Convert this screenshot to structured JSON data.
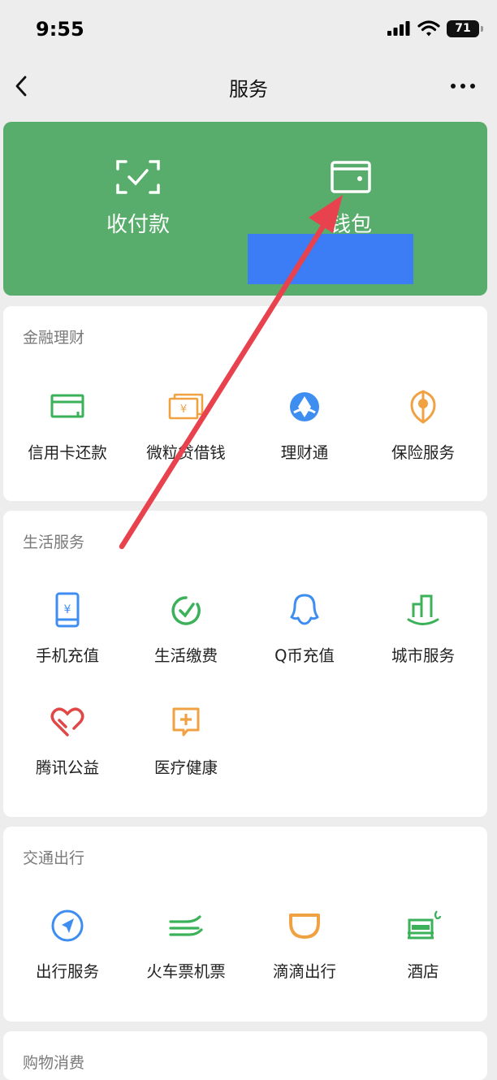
{
  "status_bar": {
    "time": "9:55",
    "battery": "71"
  },
  "nav": {
    "title": "服务"
  },
  "top_card": {
    "items": [
      {
        "label": "收付款",
        "icon": "scan-pay-icon"
      },
      {
        "label": "钱包",
        "icon": "wallet-icon"
      }
    ],
    "redaction_color": "#3c7cf4"
  },
  "sections": [
    {
      "title": "金融理财",
      "items": [
        {
          "label": "信用卡还款",
          "icon": "credit-card-icon"
        },
        {
          "label": "微粒贷借钱",
          "icon": "loan-icon"
        },
        {
          "label": "理财通",
          "icon": "wealth-icon"
        },
        {
          "label": "保险服务",
          "icon": "insurance-icon"
        }
      ]
    },
    {
      "title": "生活服务",
      "items": [
        {
          "label": "手机充值",
          "icon": "phone-topup-icon"
        },
        {
          "label": "生活缴费",
          "icon": "utility-bill-icon"
        },
        {
          "label": "Q币充值",
          "icon": "qq-coin-icon"
        },
        {
          "label": "城市服务",
          "icon": "city-service-icon"
        },
        {
          "label": "腾讯公益",
          "icon": "charity-icon"
        },
        {
          "label": "医疗健康",
          "icon": "medical-icon"
        }
      ]
    },
    {
      "title": "交通出行",
      "items": [
        {
          "label": "出行服务",
          "icon": "travel-icon"
        },
        {
          "label": "火车票机票",
          "icon": "train-ticket-icon"
        },
        {
          "label": "滴滴出行",
          "icon": "didi-icon"
        },
        {
          "label": "酒店",
          "icon": "hotel-icon"
        }
      ]
    },
    {
      "title": "购物消费",
      "items": []
    }
  ],
  "colors": {
    "brand_green": "#58ad6c",
    "annotation_arrow": "#e8424e",
    "icon_green": "#3bb15a",
    "icon_orange": "#f0a243",
    "icon_blue": "#3d8ef0",
    "icon_red": "#e04848"
  }
}
